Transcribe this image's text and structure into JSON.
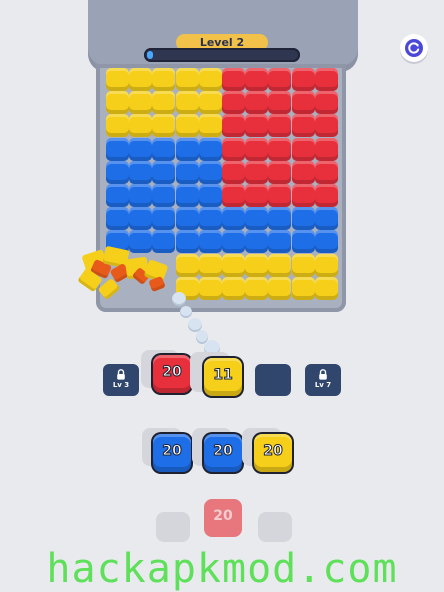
{
  "hud": {
    "level_label": "Level 2",
    "progress_fraction": 0.04,
    "restart_icon": "restart-icon"
  },
  "board": {
    "rows": 10,
    "cols": 10,
    "cells": [
      "YYYYYRRRRR",
      "YYYYYRRRRR",
      "YYYYYRRRRR",
      "BBBBBRRRRR",
      "BBBBBRRRRR",
      "BBBBBRRRRR",
      "BBBBBBBBBB",
      "BBBBBBBBBB",
      "...YYYYYYY",
      "...YYYYYYY"
    ],
    "colors": {
      "R": "#e8303d",
      "B": "#1e6ee8",
      "Y": "#f5cf19"
    }
  },
  "queue": {
    "slots": [
      {
        "type": "locked",
        "label": "Lv 3"
      },
      {
        "type": "shooter",
        "color": "red",
        "value": "20"
      },
      {
        "type": "shooter",
        "color": "yellow",
        "value": "11"
      },
      {
        "type": "empty"
      },
      {
        "type": "locked",
        "label": "Lv 7"
      }
    ]
  },
  "reserve": {
    "row1": [
      {
        "color": "blue",
        "value": "20"
      },
      {
        "color": "blue",
        "value": "20"
      },
      {
        "color": "yellow",
        "value": "20"
      }
    ],
    "row2": [
      {
        "color": "red",
        "value": "20"
      }
    ]
  },
  "watermark": "hackapkmod.com"
}
